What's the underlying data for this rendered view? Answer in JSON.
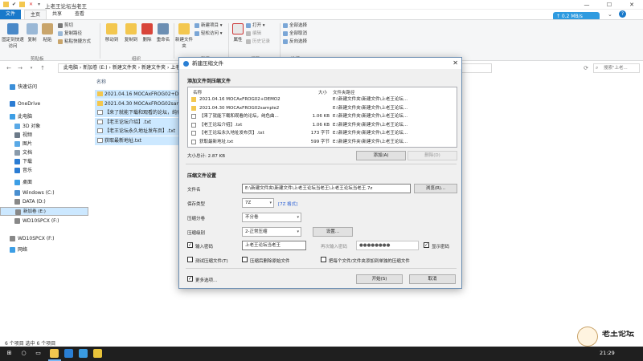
{
  "window": {
    "title": "上老王论坛当老王"
  },
  "ribbon": {
    "tabs": [
      "文件",
      "主页",
      "共享",
      "查看"
    ],
    "pin_label": "固定到快速访问",
    "copy_label": "复制",
    "paste_label": "粘贴",
    "cut_label": "剪切",
    "copy_path_label": "复制路径",
    "paste_shortcut_label": "粘贴快捷方式",
    "move_to_label": "移动到",
    "copy_to_label": "复制到",
    "delete_label": "删除",
    "rename_label": "重命名",
    "new_folder_label": "新建文件夹",
    "new_item_label": "新建项目",
    "easy_access_label": "轻松访问",
    "properties_label": "属性",
    "open_label": "打开",
    "edit_label": "编辑",
    "history_label": "历史记录",
    "select_all_label": "全部选择",
    "select_none_label": "全部取消",
    "invert_label": "反向选择",
    "group_clipboard": "剪贴板",
    "group_organize": "组织",
    "group_new": "新建",
    "group_open": "打开",
    "group_select": "选择",
    "speed_badge": "↑ 0.2 MB/s"
  },
  "address": {
    "path": "此电脑 › 新加卷 (E:) › 新建文件夹 › 新建文件夹 › 上老王论坛当老王",
    "search_placeholder": "搜索\"上老..."
  },
  "nav": [
    {
      "label": "快速访问",
      "icon": "star-icon",
      "color": "#3b8fd9"
    },
    {
      "label": "OneDrive",
      "icon": "cloud-icon",
      "color": "#2b7cd3"
    },
    {
      "label": "此电脑",
      "icon": "computer-icon",
      "color": "#3c9ee5"
    },
    {
      "label": "3D 对象",
      "icon": "cube-icon",
      "color": "#5aa9e6"
    },
    {
      "label": "视频",
      "icon": "video-icon",
      "color": "#6c7a89"
    },
    {
      "label": "图片",
      "icon": "picture-icon",
      "color": "#5aa9e6"
    },
    {
      "label": "文档",
      "icon": "document-icon",
      "color": "#8a9bab"
    },
    {
      "label": "下载",
      "icon": "download-icon",
      "color": "#2b7cd3"
    },
    {
      "label": "音乐",
      "icon": "music-icon",
      "color": "#2b7cd3"
    },
    {
      "label": "桌面",
      "icon": "desktop-icon",
      "color": "#3c9ee5"
    },
    {
      "label": "Windows (C:)",
      "icon": "drive-icon",
      "color": "#4a8fcf"
    },
    {
      "label": "DATA (D:)",
      "icon": "drive-icon",
      "color": "#888"
    },
    {
      "label": "新加卷 (E:)",
      "icon": "drive-icon",
      "color": "#888"
    },
    {
      "label": "WD10SPCX (F:)",
      "icon": "drive-icon",
      "color": "#888"
    },
    {
      "label": "WD10SPCX (F:)",
      "icon": "drive-icon",
      "color": "#888"
    },
    {
      "label": "网络",
      "icon": "network-icon",
      "color": "#3c9ee5"
    }
  ],
  "filelist": {
    "column_header": "名称",
    "items": [
      {
        "name": "2021.04.16 MOCAxFROG02+DEMO2",
        "type": "folder"
      },
      {
        "name": "2021.04.30 MOCAxFROG02sample2",
        "type": "folder"
      },
      {
        "name": "【来了就能下载和观看的论坛，纯色...",
        "type": "file"
      },
      {
        "name": "【老王论坛介绍】.txt",
        "type": "file"
      },
      {
        "name": "【老王论坛永久地址发布页】.txt",
        "type": "file"
      },
      {
        "name": "获取最新地址.txt",
        "type": "file"
      }
    ]
  },
  "status": {
    "text": "6 个项目   选中 6 个项目"
  },
  "taskbar": {
    "clock": "21:29"
  },
  "logo": {
    "text": "老王论坛"
  },
  "dialog": {
    "title": "新建压缩文件",
    "add_section": "添加文件到压缩文件",
    "col_name": "名称",
    "col_size": "大小",
    "col_path": "文件夹路径",
    "rows": [
      {
        "name": "2021.04.16  MOCAxFROG02+DEMO2",
        "size": "",
        "path": "E:\\新建文件夹\\新建文件\\上老王论坛...",
        "type": "folder"
      },
      {
        "name": "2021.04.30  MOCAxFROG02sample2",
        "size": "",
        "path": "E:\\新建文件夹\\新建文件\\上老王论坛...",
        "type": "folder"
      },
      {
        "name": "【来了就能下载和观看的论坛，纯色曲...",
        "size": "1.06 KB",
        "path": "E:\\新建文件夹\\新建文件\\上老王论坛...",
        "type": "file"
      },
      {
        "name": "【老王论坛介绍】.txt",
        "size": "1.06 KB",
        "path": "E:\\新建文件夹\\新建文件\\上老王论坛...",
        "type": "file"
      },
      {
        "name": "【老王论坛永久地址发布页】.txt",
        "size": "173 字节",
        "path": "E:\\新建文件夹\\新建文件\\上老王论坛...",
        "type": "file"
      },
      {
        "name": "获取最新地址.txt",
        "size": "599 字节",
        "path": "E:\\新建文件夹\\新建文件\\上老王论坛...",
        "type": "file"
      }
    ],
    "total_size": "大小总计: 2.87 KB",
    "add_button": "添加(A)",
    "delete_button": "删除(D)",
    "settings_section": "压缩文件设置",
    "filename_label": "文件名",
    "filename_value": "E:\\新建文件夹\\新建文件\\上老王论坛当老王\\上老王论坛当老王.7z",
    "browse_button": "浏览(R)...",
    "format_label": "保存类型",
    "format_value": "7Z",
    "format_link": "[7Z 格式]",
    "split_label": "压缩分卷",
    "split_value": "不分卷",
    "level_label": "压缩级别",
    "level_value": "2-正常压缩",
    "settings_button": "设置...",
    "password_check_label": "输入密码",
    "password_value": "上老王论坛当老王",
    "reenter_label": "再次输入密码",
    "reenter_value": "●●●●●●●●",
    "show_password_label": "显示密码",
    "test_label": "测试压缩文件(T)",
    "delete_after_label": "压缩后删除原始文件",
    "separate_label": "把每个文件/文件夹添加到单独的压缩文件",
    "more_label": "更多选项...",
    "start_button": "开始(S)",
    "cancel_button": "取消"
  }
}
